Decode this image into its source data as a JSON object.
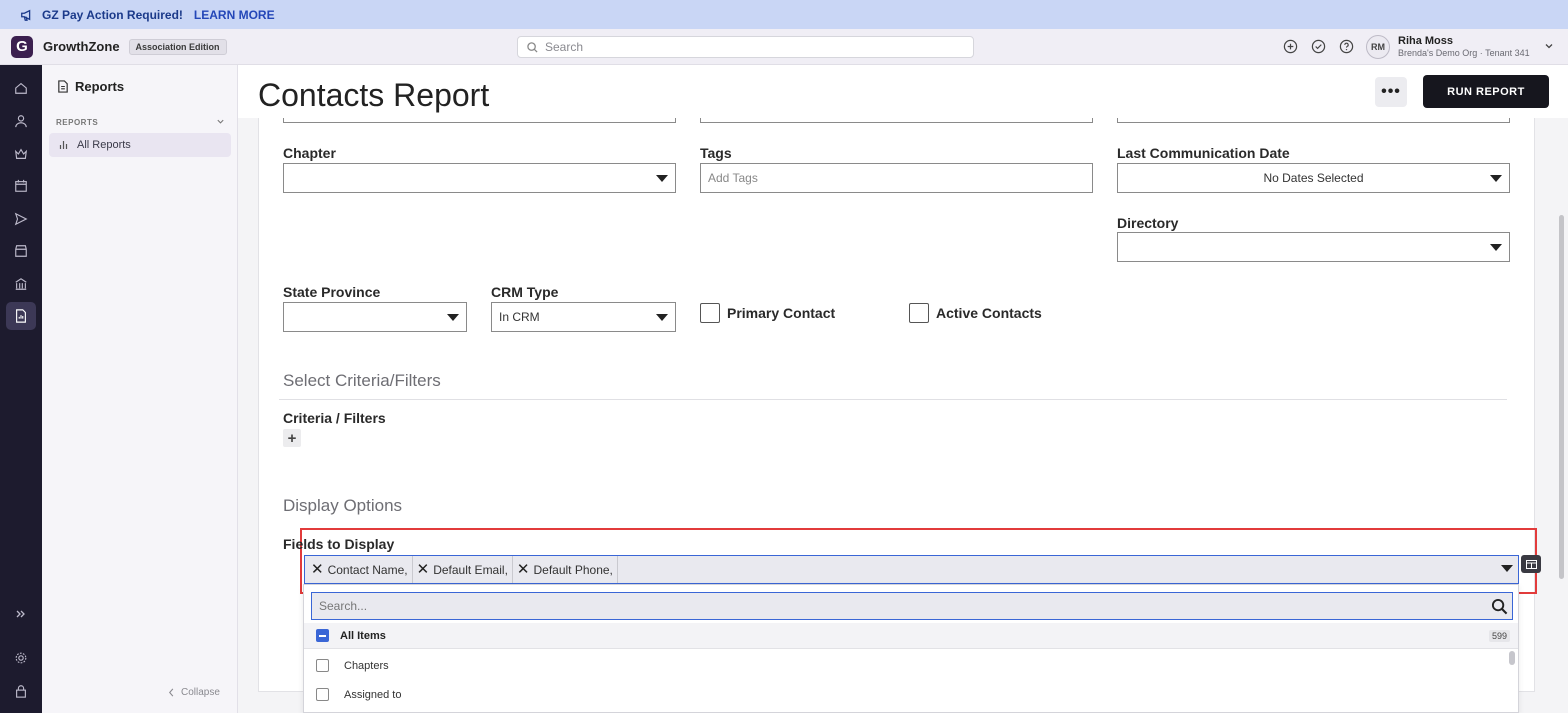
{
  "banner": {
    "message": "GZ Pay Action Required!",
    "link": "LEARN MORE"
  },
  "header": {
    "logo_letter": "G",
    "brand": "GrowthZone",
    "edition": "Association Edition",
    "search_placeholder": "Search",
    "user_initials": "RM",
    "user_name": "Riha Moss",
    "user_org": "Brenda's Demo Org · Tenant 341"
  },
  "sidebar": {
    "title": "Reports",
    "section": "REPORTS",
    "items": [
      {
        "label": "All Reports"
      }
    ],
    "collapse_label": "Collapse"
  },
  "page": {
    "title": "Contacts Report",
    "more_label": "•••",
    "run_label": "RUN REPORT"
  },
  "form": {
    "chapter": {
      "label": "Chapter",
      "value": ""
    },
    "tags": {
      "label": "Tags",
      "placeholder": "Add Tags"
    },
    "last_comm": {
      "label": "Last Communication Date",
      "value": "No Dates Selected"
    },
    "directory": {
      "label": "Directory",
      "value": ""
    },
    "state": {
      "label": "State Province",
      "value": ""
    },
    "crm_type": {
      "label": "CRM Type",
      "value": "In CRM"
    },
    "primary_contact": {
      "label": "Primary Contact",
      "checked": false
    },
    "active_contacts": {
      "label": "Active Contacts",
      "checked": false
    }
  },
  "criteria": {
    "section_title": "Select Criteria/Filters",
    "label": "Criteria / Filters",
    "add": "+"
  },
  "display": {
    "section_title": "Display Options",
    "fields_label": "Fields to Display",
    "selected": [
      "Contact Name,",
      "Default Email,",
      "Default Phone,"
    ],
    "dropdown": {
      "search_placeholder": "Search...",
      "all_items_label": "All Items",
      "count": "599",
      "items": [
        "Chapters",
        "Assigned to"
      ]
    }
  },
  "colors": {
    "accent": "#3a66d6",
    "highlight": "#e23b3b",
    "rail": "#1d1b2e",
    "banner": "#c9d6f5"
  }
}
